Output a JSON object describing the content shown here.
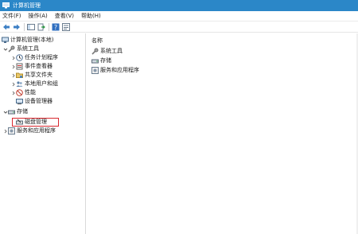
{
  "window": {
    "title": "计算机管理"
  },
  "menu": [
    "文件(F)",
    "操作(A)",
    "查看(V)",
    "帮助(H)"
  ],
  "toolbar": {
    "buttons": [
      "back-arrow-icon",
      "forward-arrow-icon",
      "console-tree-icon",
      "export-icon",
      "help-icon",
      "properties-icon"
    ]
  },
  "tree": {
    "root": "计算机管理(本地)",
    "system_tools": "系统工具",
    "task_scheduler": "任务计划程序",
    "event_viewer": "事件查看器",
    "shared_folders": "共享文件夹",
    "local_users": "本地用户和组",
    "performance": "性能",
    "device_manager": "设备管理器",
    "storage": "存储",
    "disk_management": "磁盘管理",
    "services_apps": "服务和应用程序"
  },
  "list": {
    "header": "名称",
    "items": [
      "系统工具",
      "存储",
      "服务和应用程序"
    ]
  },
  "colors": {
    "titlebar": "#2b87c8",
    "highlight": "#d8282f"
  }
}
